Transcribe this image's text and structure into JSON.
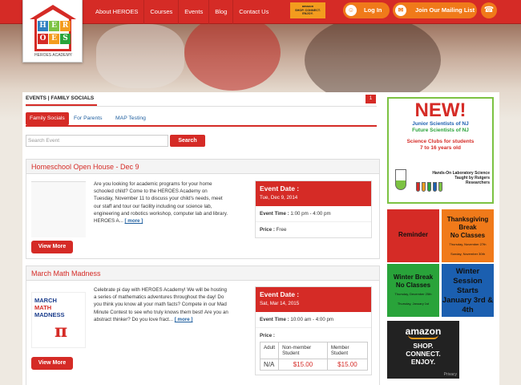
{
  "header": {
    "logo_letters": [
      "H",
      "E",
      "R",
      "O",
      "E",
      "S"
    ],
    "logo_caption": "HEROES ACADEMY",
    "nav": [
      "About HEROES",
      "Courses",
      "Events",
      "Blog",
      "Contact Us"
    ],
    "amazon_small": "amazon\nSHOP. CONNECT. ENJOY.",
    "login_label": "Log In",
    "mailing_label": "Join Our Mailing List",
    "colors": {
      "brand_red": "#d52b26",
      "accent_orange": "#f07a1a"
    }
  },
  "main": {
    "section_title": "EVENTS | FAMILY SOCIALS",
    "badge": "1",
    "filter_tabs": [
      "Family Socials",
      "For Parents",
      "MAP Testing"
    ],
    "search_placeholder": "Search Event",
    "search_button": "Search",
    "events": [
      {
        "title": "Homeschool Open House - Dec 9",
        "description": "Are you looking for academic programs for your home schooled child?  Come to the HEROES Academy on Tuesday, November 11 to discuss your child's needs, meet our staff and tour our facility including our science lab, engineering and robotics workshop, computer lab and library. HEROES A...",
        "more_link": "[ more ]",
        "date_heading": "Event Date :",
        "date": "Tue, Dec 9, 2014",
        "time_label": "Event Time :",
        "time": "1:00 pm - 4:00 pm",
        "price_label": "Price :",
        "price": "Free",
        "button": "View More"
      },
      {
        "title": "March Math Madness",
        "image_text": [
          "MARCH",
          "MATH",
          "MADNESS",
          "π"
        ],
        "description": "Celebrate pi day with HEROES Academy!  We will be hosting a series of mathematics adventures throughout the day!  Do you think you know all your math facts?  Compete in our Mad Minute Contest to see who truly knows them best!  Are you an abstract thinker?  Do you love fract...",
        "more_link": "[ more ]",
        "date_heading": "Event Date :",
        "date": "Sat, Mar 14, 2015",
        "time_label": "Event Time :",
        "time": "10:00 am - 4:00 pm",
        "price_label": "Price :",
        "price_table": {
          "headers": [
            "Adult",
            "Non-member Student",
            "Member Student"
          ],
          "row": [
            "N/A",
            "$15.00",
            "$15.00"
          ]
        },
        "button": "View More"
      }
    ]
  },
  "sidebar": {
    "new_ad": {
      "headline": "NEW!",
      "line1": "Junior Scientists of NJ",
      "line2": "Future Scientists of NJ",
      "line3": "Science Clubs for students\n7 to 16 years old",
      "hands_on": "Hands-On Laboratory Science Taught by Rutgers Researchers"
    },
    "calendar": [
      {
        "main": "Reminder",
        "sub": "",
        "bg": "#d52b26"
      },
      {
        "main": "Thanksgiving Break\nNo Classes",
        "sub": "Thursday, November 27th\n\nSunday, November 30th",
        "bg": "#f07a1a"
      },
      {
        "main": "Winter Break\nNo Classes",
        "sub": "Thursday, December 25th\n\nThursday, January 1st",
        "bg": "#29a33a"
      },
      {
        "main": "Winter Session Starts\nJanuary 3rd & 4th",
        "sub": "",
        "bg": "#1b5fb0"
      }
    ],
    "amazon": {
      "logo": "amazon",
      "tagline": "SHOP.\nCONNECT.\nENJOY.",
      "privacy": "Privacy"
    }
  }
}
